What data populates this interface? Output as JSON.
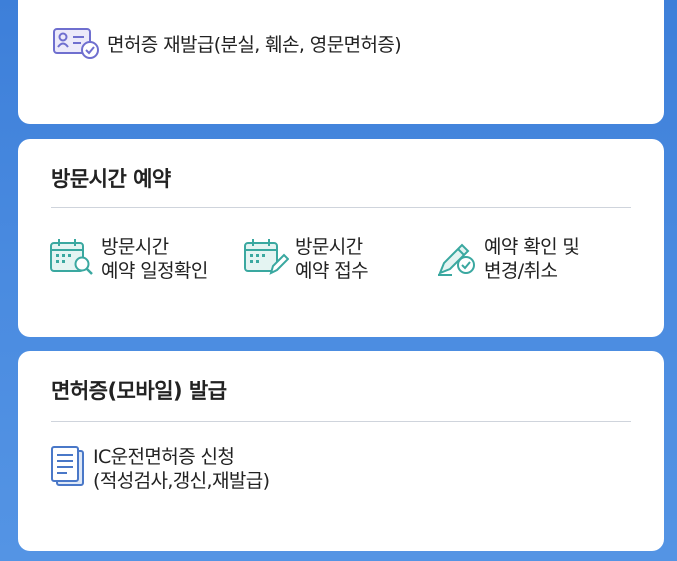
{
  "license_reissue": {
    "label": "면허증 재발급(분실, 훼손, 영문면허증)"
  },
  "visit_reservation": {
    "title": "방문시간 예약",
    "items": [
      {
        "line1": "방문시간",
        "line2": "예약 일정확인"
      },
      {
        "line1": "방문시간",
        "line2": "예약 접수"
      },
      {
        "line1": "예약 확인 및",
        "line2": "변경/취소"
      }
    ]
  },
  "mobile_license": {
    "title": "면허증(모바일) 발급",
    "item": {
      "line1": "IC운전면허증 신청",
      "line2": "(적성검사,갱신,재발급)"
    }
  },
  "colors": {
    "background": "#3d7fd9",
    "teal_icon": "#3aa8a0",
    "purple_icon": "#6f6fcf",
    "blue_icon": "#4a78c8"
  }
}
